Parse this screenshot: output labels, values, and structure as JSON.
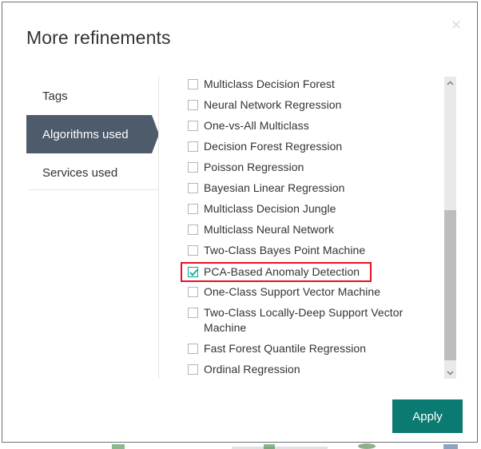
{
  "dialog": {
    "title": "More refinements",
    "close_label": "✕",
    "close_icon": "close-icon"
  },
  "tabs": {
    "items": [
      {
        "label": "Tags",
        "selected": false
      },
      {
        "label": "Algorithms used",
        "selected": true
      },
      {
        "label": "Services used",
        "selected": false
      }
    ]
  },
  "list": {
    "items": [
      {
        "label": "Multiclass Decision Forest",
        "checked": false,
        "highlighted": false
      },
      {
        "label": "Neural Network Regression",
        "checked": false,
        "highlighted": false
      },
      {
        "label": "One-vs-All Multiclass",
        "checked": false,
        "highlighted": false
      },
      {
        "label": "Decision Forest Regression",
        "checked": false,
        "highlighted": false
      },
      {
        "label": "Poisson Regression",
        "checked": false,
        "highlighted": false
      },
      {
        "label": "Bayesian Linear Regression",
        "checked": false,
        "highlighted": false
      },
      {
        "label": "Multiclass Decision Jungle",
        "checked": false,
        "highlighted": false
      },
      {
        "label": "Multiclass Neural Network",
        "checked": false,
        "highlighted": false
      },
      {
        "label": "Two-Class Bayes Point Machine",
        "checked": false,
        "highlighted": false
      },
      {
        "label": "PCA-Based Anomaly Detection",
        "checked": true,
        "highlighted": true
      },
      {
        "label": "One-Class Support Vector Machine",
        "checked": false,
        "highlighted": false
      },
      {
        "label": "Two-Class Locally-Deep Support Vector Machine",
        "checked": false,
        "highlighted": false
      },
      {
        "label": "Fast Forest Quantile Regression",
        "checked": false,
        "highlighted": false
      },
      {
        "label": "Ordinal Regression",
        "checked": false,
        "highlighted": false
      }
    ]
  },
  "scrollbar": {
    "up_icon": "chevron-up-icon",
    "down_icon": "chevron-down-icon"
  },
  "footer": {
    "apply_label": "Apply"
  },
  "colors": {
    "accent_teal": "#0b7a71",
    "checkbox_teal": "#00a88f",
    "tab_selected": "#4e5b6b",
    "highlight_red": "#e81123",
    "text": "#333333"
  }
}
